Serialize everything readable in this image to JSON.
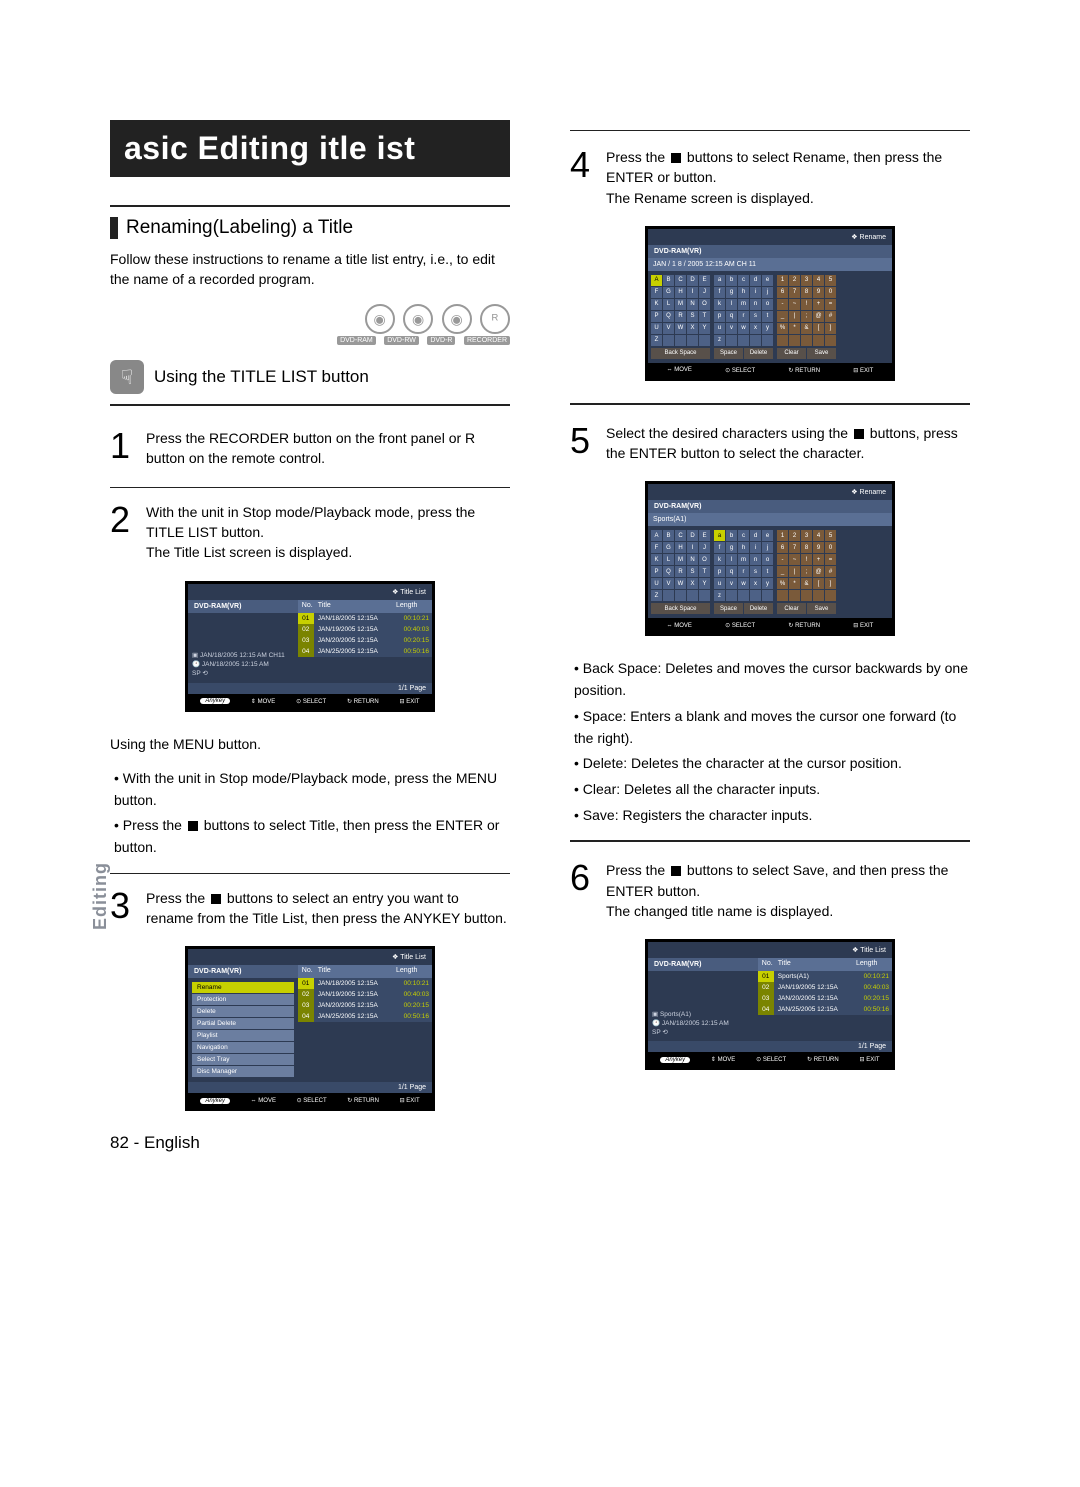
{
  "page": {
    "main_title": "asic Editing   itle  ist",
    "side_tab": "Editing",
    "footer": "82 - English"
  },
  "sectionA": {
    "title": "Renaming(Labeling) a Title",
    "intro": "Follow these instructions to rename a title list entry, i.e., to edit the name of a recorded program.",
    "disc_labels": {
      "a": "DVD-RAM",
      "b": "DVD-RW",
      "c": "DVD-R",
      "d": "RECORDER"
    },
    "hand_title": "Using the TITLE LIST button"
  },
  "steps_left": {
    "s1": "Press the RECORDER button on the front panel or R button on the remote control.",
    "s2a": "With the unit in Stop mode/Playback mode, press the TITLE LIST button.",
    "s2b": "The Title List screen is displayed.",
    "menu_label": "Using the MENU button.",
    "menu_b1": "• With the unit in Stop mode/Playback mode, press the MENU button.",
    "menu_b2_a": "• Press the ",
    "menu_b2_b": " buttons to select Title, then press the ENTER or      button.",
    "s3a": "Press the ",
    "s3b": " buttons to select an entry you want to rename from the Title List, then press the ANYKEY button."
  },
  "steps_right": {
    "s4a": "Press the ",
    "s4b": " buttons to select Rename, then press the ENTER or      button.",
    "s4c": "The Rename screen is displayed.",
    "s5a": "Select the desired characters using the ",
    "s5b": " buttons, press the ENTER button to select the character.",
    "bs": "• Back Space:  Deletes and moves the cursor backwards by one position.",
    "sp": "• Space:  Enters a blank and moves the cursor one forward (to the right).",
    "del": "• Delete:  Deletes the character at the cursor position.",
    "clr": "• Clear:  Deletes all the character inputs.",
    "sv": "• Save:  Registers the character inputs.",
    "s6a": "Press the ",
    "s6b": " buttons to select Save, and then press the ENTER button.",
    "s6c": "The changed title name is displayed."
  },
  "osd": {
    "dvd_label": "DVD-RAM(VR)",
    "title_list": "Title List",
    "rename": "Rename",
    "hdr_no": "No.",
    "hdr_title": "Title",
    "hdr_len": "Length",
    "rows": [
      {
        "no": "01",
        "title": "JAN/18/2005 12:15A",
        "len": "00:10:21"
      },
      {
        "no": "02",
        "title": "JAN/19/2005 12:15A",
        "len": "00:40:03"
      },
      {
        "no": "03",
        "title": "JAN/20/2005 12:15A",
        "len": "00:20:15"
      },
      {
        "no": "04",
        "title": "JAN/25/2005 12:15A",
        "len": "00:50:16"
      }
    ],
    "info1": "JAN/18/2005 12:15 AM CH11",
    "info2": "JAN/18/2005 12:15 AM",
    "sp_lbl": "SP",
    "page": "1/1 Page",
    "foot": {
      "anykey": "Anykey",
      "move": "MOVE",
      "select": "SELECT",
      "return": "RETURN",
      "exit": "EXIT"
    },
    "menu": [
      "Rename",
      "Protection",
      "Delete",
      "Partial Delete",
      "Playlist",
      "Navigation",
      "Select Tray",
      "Disc Manager"
    ],
    "kbd_upper": [
      [
        "A",
        "B",
        "C",
        "D",
        "E"
      ],
      [
        "F",
        "G",
        "H",
        "I",
        "J"
      ],
      [
        "K",
        "L",
        "M",
        "N",
        "O"
      ],
      [
        "P",
        "Q",
        "R",
        "S",
        "T"
      ],
      [
        "U",
        "V",
        "W",
        "X",
        "Y"
      ],
      [
        "Z",
        "",
        "",
        "",
        ""
      ]
    ],
    "kbd_lower": [
      [
        "a",
        "b",
        "c",
        "d",
        "e"
      ],
      [
        "f",
        "g",
        "h",
        "i",
        "j"
      ],
      [
        "k",
        "l",
        "m",
        "n",
        "o"
      ],
      [
        "p",
        "q",
        "r",
        "s",
        "t"
      ],
      [
        "u",
        "v",
        "w",
        "x",
        "y"
      ],
      [
        "z",
        "",
        "",
        "",
        ""
      ]
    ],
    "kbd_num": [
      [
        "1",
        "2",
        "3",
        "4",
        "5"
      ],
      [
        "6",
        "7",
        "8",
        "9",
        "0"
      ],
      [
        "-",
        "~",
        "!",
        "+",
        "="
      ],
      [
        "_",
        "|",
        ";",
        "@",
        "#"
      ],
      [
        "%",
        "*",
        "&",
        "[",
        "]"
      ],
      [
        "",
        "",
        "",
        "",
        ""
      ]
    ],
    "kbd_btns": {
      "back": "Back Space",
      "space": "Space",
      "delete": "Delete",
      "clear": "Clear",
      "save": "Save"
    },
    "rename_hdr1": "JAN / 1 8 / 2005 12:15 AM CH 11",
    "sports_hdr": "Sports(A1)",
    "sports_row_title": "Sports(A1)",
    "info_sports": "Sports(A1)"
  }
}
